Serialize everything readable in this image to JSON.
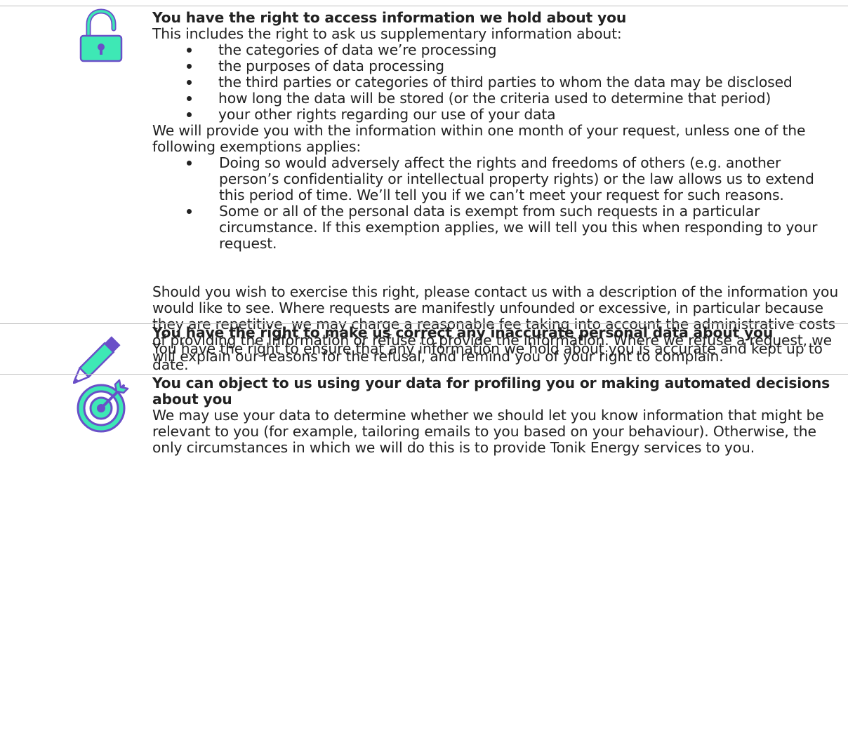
{
  "sections": [
    {
      "icon": "unlocked-padlock-icon",
      "title": "You have the right to access information we hold about you",
      "intro": "This includes the right to ask us supplementary information about:",
      "bullets": [
        "the categories of data we’re processing",
        "the purposes of data processing",
        "the third parties or categories of third parties to whom the data may be disclosed",
        "how long the data will be stored (or the criteria used to determine that period)",
        "your other rights regarding our use of your data"
      ],
      "para1": "We will provide you with the information within one month of your request, unless one of the following exemptions applies:",
      "bullets2": [
        "Doing so would adversely affect the rights and freedoms of others (e.g. another person’s confidentiality or intellectual property rights) or the law allows us to extend this period of time. We’ll tell you if we can’t meet your request for such reasons.",
        "Some or all of the personal data is exempt from such requests in a particular circumstance. If this exemption applies, we will tell you this when responding to your request."
      ],
      "para2": "Should you wish to exercise this right, please contact us with a description of the information you would like to see. Where requests are manifestly unfounded or excessive, in particular because they are repetitive, we may charge a reasonable fee taking into account the administrative costs of providing the information or refuse to provide the information. Where we refuse a request, we will explain our reasons for the refusal, and remind you of your right to complain."
    },
    {
      "icon": "pencil-icon",
      "title": "You have the right to make us correct any inaccurate personal data about you",
      "body": "You have the right to ensure that any information we hold about you is accurate and kept up to date."
    },
    {
      "icon": "target-icon",
      "title": "You can object to us using your data for profiling you or making automated decisions about you",
      "body": "We may use your data to determine whether we should let you know information that might be relevant to you (for example, tailoring emails to you based on your behaviour). Otherwise, the only circumstances in which we will do this is to provide Tonik Energy services to you."
    }
  ],
  "colors": {
    "icon_fill": "#3ee8b5",
    "icon_stroke": "#6a4fc8",
    "divider": "#bfbfbf",
    "text": "#222222"
  }
}
